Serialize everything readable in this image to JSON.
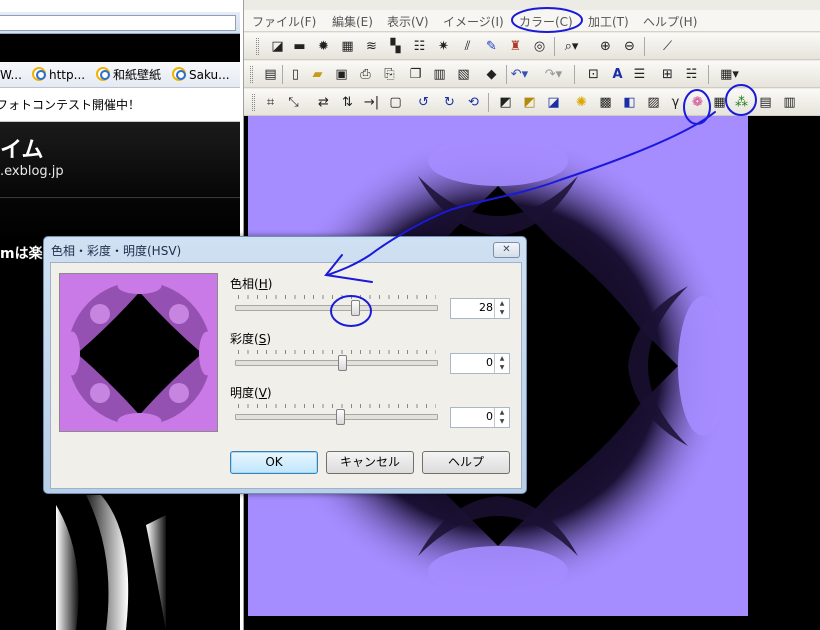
{
  "browser": {
    "favorites": [
      {
        "label": "W..."
      },
      {
        "label": "http..."
      },
      {
        "label": "和紙壁紙"
      },
      {
        "label": "Saku..."
      }
    ],
    "info_text": "フォトコンテスト開催中！",
    "blog_title": "イム",
    "blog_url": ".exblog.jp",
    "blog_heading": "mは楽"
  },
  "editor": {
    "menu": [
      {
        "label": "ファイル(F)"
      },
      {
        "label": "編集(E)"
      },
      {
        "label": "表示(V)"
      },
      {
        "label": "イメージ(I)"
      },
      {
        "label": "カラー(C)"
      },
      {
        "label": "加工(T)"
      },
      {
        "label": "ヘルプ(H)"
      }
    ],
    "image_color": "#a58cff"
  },
  "dialog": {
    "title": "色相・彩度・明度(HSV)",
    "close_glyph": "✕",
    "hue": {
      "label": "色相(",
      "key": "H",
      "suffix": ")",
      "value": "28"
    },
    "saturation": {
      "label": "彩度(",
      "key": "S",
      "suffix": ")",
      "value": "0"
    },
    "brightness": {
      "label": "明度(",
      "key": "V",
      "suffix": ")",
      "value": "0"
    },
    "ok_label": "OK",
    "cancel_label": "キャンセル",
    "help_label": "ヘルプ",
    "preview_color": "#c97ae6"
  },
  "colors": {
    "annotation": "#1a1adb",
    "dialog_frame": "#b9cfe8",
    "ok_accent": "#3c7fb1"
  }
}
